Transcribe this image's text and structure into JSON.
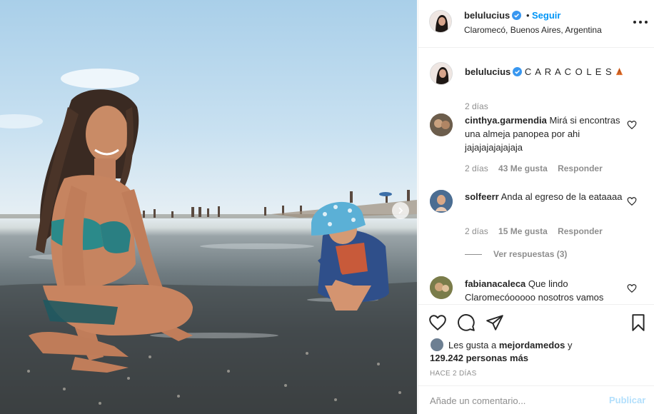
{
  "post": {
    "author": "belulucius",
    "follow_label": "Seguir",
    "dot": "•",
    "location": "Claromecó, Buenos Aires, Argentina",
    "caption": "C A R A C O L E S",
    "caption_time": "2 días"
  },
  "comments": [
    {
      "user": "cinthya.garmendia",
      "text": "Mirá si encontras una almeja panopea por ahi jajajajajajajaja",
      "time": "2 días",
      "likes": "43 Me gusta",
      "reply": "Responder"
    },
    {
      "user": "solfeerr",
      "text": "Anda al egreso de la eataaaa",
      "time": "2 días",
      "likes": "15 Me gusta",
      "reply": "Responder",
      "view_replies": "Ver respuestas (3)"
    },
    {
      "user": "fabianacaleca",
      "text": "Que lindo Claromecóooooo nosotros vamos"
    }
  ],
  "likes": {
    "prefix": "Les gusta a",
    "user": "mejordamedos",
    "connector": "y",
    "count": "129.242 personas más"
  },
  "posted_ago": "HACE 2 DÍAS",
  "add_comment": {
    "placeholder": "Añade un comentario...",
    "publish": "Publicar"
  },
  "colors": {
    "link_blue": "#0095f6",
    "verified_blue": "#3897f0",
    "publish_disabled": "#b2dffc"
  },
  "icons": [
    "verified-badge-icon",
    "more-options-icon",
    "heart-icon",
    "comment-icon",
    "share-icon",
    "save-icon",
    "next-arrow-icon"
  ]
}
